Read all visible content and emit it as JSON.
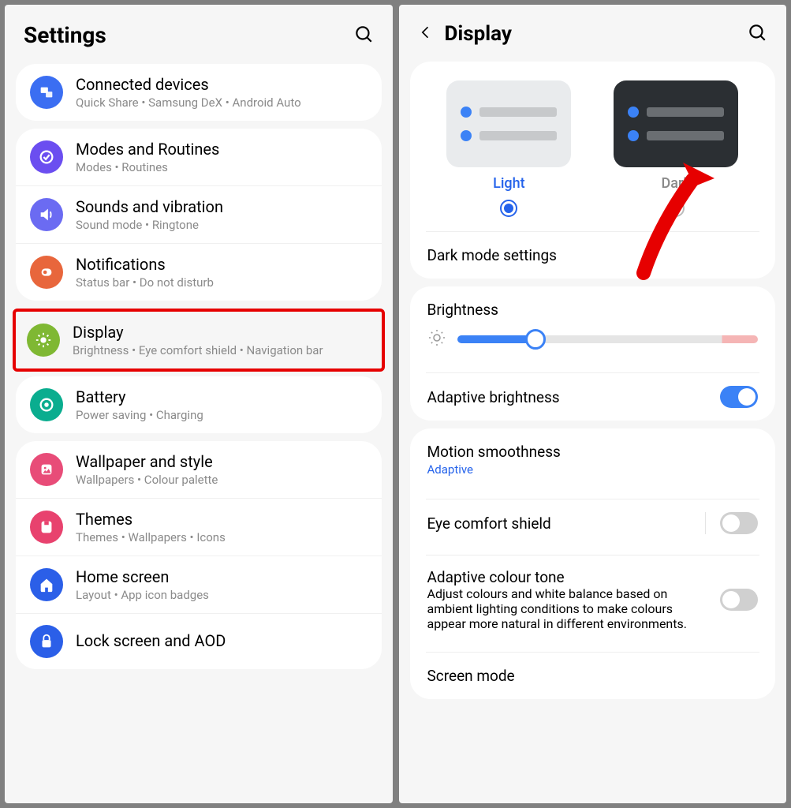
{
  "left": {
    "title": "Settings",
    "groups": [
      [
        {
          "icon": "connected",
          "color": "#3b6ef2",
          "title": "Connected devices",
          "sub": "Quick Share  •  Samsung DeX  •  Android Auto"
        }
      ],
      [
        {
          "icon": "modes",
          "color": "#6b4ef0",
          "title": "Modes and Routines",
          "sub": "Modes  •  Routines"
        },
        {
          "icon": "sound",
          "color": "#6b6bf2",
          "title": "Sounds and vibration",
          "sub": "Sound mode  •  Ringtone"
        },
        {
          "icon": "notifications",
          "color": "#e8663c",
          "title": "Notifications",
          "sub": "Status bar  •  Do not disturb"
        }
      ],
      [
        {
          "icon": "display",
          "color": "#7fb833",
          "title": "Display",
          "sub": "Brightness  •  Eye comfort shield  •  Navigation bar",
          "highlighted": true
        },
        {
          "icon": "battery",
          "color": "#0aad8f",
          "title": "Battery",
          "sub": "Power saving  •  Charging"
        }
      ],
      [
        {
          "icon": "wallpaper",
          "color": "#e84c78",
          "title": "Wallpaper and style",
          "sub": "Wallpapers  •  Colour palette"
        },
        {
          "icon": "themes",
          "color": "#e8426e",
          "title": "Themes",
          "sub": "Themes  •  Wallpapers  •  Icons"
        },
        {
          "icon": "home",
          "color": "#2b5fe8",
          "title": "Home screen",
          "sub": "Layout  •  App icon badges"
        },
        {
          "icon": "lock",
          "color": "#2b5fe8",
          "title": "Lock screen and AOD",
          "sub": ""
        }
      ]
    ]
  },
  "right": {
    "title": "Display",
    "theme": {
      "light_label": "Light",
      "dark_label": "Dark",
      "selected": "light"
    },
    "dark_mode_label": "Dark mode settings",
    "brightness_label": "Brightness",
    "adaptive_brightness": {
      "label": "Adaptive brightness",
      "on": true
    },
    "motion": {
      "label": "Motion smoothness",
      "value": "Adaptive"
    },
    "eye_comfort": {
      "label": "Eye comfort shield",
      "on": false
    },
    "colour_tone": {
      "label": "Adaptive colour tone",
      "desc": "Adjust colours and white balance based on ambient lighting conditions to make colours appear more natural in different environments.",
      "on": false
    },
    "screen_mode_label": "Screen mode"
  },
  "icon_colors": {
    "connected": "#3b6ef2",
    "modes": "#6b4ef0",
    "sound": "#6b6bf2",
    "notifications": "#e8663c",
    "display": "#7fb833",
    "battery": "#0aad8f",
    "wallpaper": "#e84c78",
    "themes": "#e8426e",
    "home": "#2b5fe8",
    "lock": "#2b5fe8"
  }
}
